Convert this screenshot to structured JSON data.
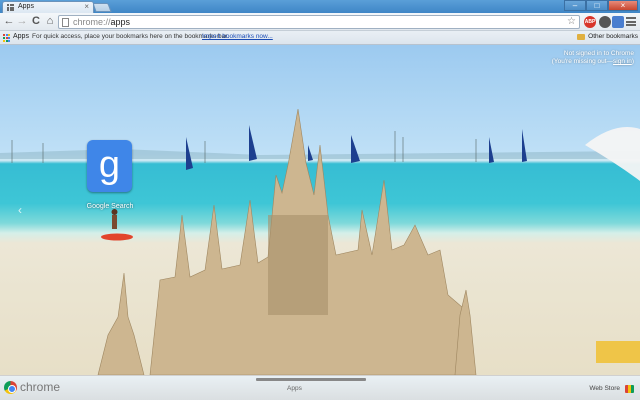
{
  "window": {
    "tab_title": "Apps",
    "tab_close": "×",
    "controls": {
      "minimize": "–",
      "maximize": "□",
      "close": "×"
    }
  },
  "toolbar": {
    "back": "←",
    "forward": "→",
    "reload": "C",
    "home": "⌂",
    "url_scheme": "chrome://",
    "url_path": "apps",
    "star": "☆",
    "adblock_label": "ABP"
  },
  "bookmarks": {
    "apps_label": "Apps",
    "hint": "For quick access, place your bookmarks here on the bookmarks bar.",
    "import_link": "Import bookmarks now...",
    "other_label": "Other bookmarks"
  },
  "ntp": {
    "signin_line1": "Not signed in to Chrome",
    "signin_line2_prefix": "(You're missing out—",
    "signin_link": "sign in",
    "signin_line2_suffix": ")",
    "prev_page_arrow": "‹",
    "apps": [
      {
        "label": "Google Search",
        "icon": "google-search-icon",
        "glyph": "g",
        "color": "#3f86e8"
      }
    ]
  },
  "footer": {
    "brand": "chrome",
    "current_page": "Apps",
    "webstore": "Web Store"
  },
  "colors": {
    "accent_blue": "#3f86e8",
    "link_blue": "#1a4bb5"
  }
}
